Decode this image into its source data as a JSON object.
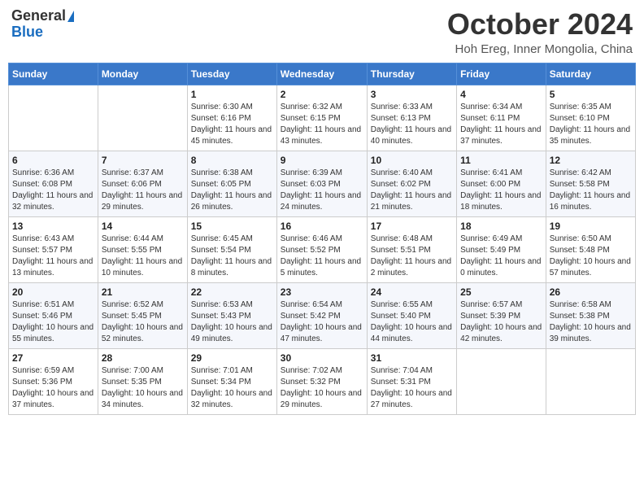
{
  "header": {
    "logo_general": "General",
    "logo_blue": "Blue",
    "month": "October 2024",
    "location": "Hoh Ereg, Inner Mongolia, China"
  },
  "weekdays": [
    "Sunday",
    "Monday",
    "Tuesday",
    "Wednesday",
    "Thursday",
    "Friday",
    "Saturday"
  ],
  "weeks": [
    [
      {
        "day": "",
        "sunrise": "",
        "sunset": "",
        "daylight": ""
      },
      {
        "day": "",
        "sunrise": "",
        "sunset": "",
        "daylight": ""
      },
      {
        "day": "1",
        "sunrise": "Sunrise: 6:30 AM",
        "sunset": "Sunset: 6:16 PM",
        "daylight": "Daylight: 11 hours and 45 minutes."
      },
      {
        "day": "2",
        "sunrise": "Sunrise: 6:32 AM",
        "sunset": "Sunset: 6:15 PM",
        "daylight": "Daylight: 11 hours and 43 minutes."
      },
      {
        "day": "3",
        "sunrise": "Sunrise: 6:33 AM",
        "sunset": "Sunset: 6:13 PM",
        "daylight": "Daylight: 11 hours and 40 minutes."
      },
      {
        "day": "4",
        "sunrise": "Sunrise: 6:34 AM",
        "sunset": "Sunset: 6:11 PM",
        "daylight": "Daylight: 11 hours and 37 minutes."
      },
      {
        "day": "5",
        "sunrise": "Sunrise: 6:35 AM",
        "sunset": "Sunset: 6:10 PM",
        "daylight": "Daylight: 11 hours and 35 minutes."
      }
    ],
    [
      {
        "day": "6",
        "sunrise": "Sunrise: 6:36 AM",
        "sunset": "Sunset: 6:08 PM",
        "daylight": "Daylight: 11 hours and 32 minutes."
      },
      {
        "day": "7",
        "sunrise": "Sunrise: 6:37 AM",
        "sunset": "Sunset: 6:06 PM",
        "daylight": "Daylight: 11 hours and 29 minutes."
      },
      {
        "day": "8",
        "sunrise": "Sunrise: 6:38 AM",
        "sunset": "Sunset: 6:05 PM",
        "daylight": "Daylight: 11 hours and 26 minutes."
      },
      {
        "day": "9",
        "sunrise": "Sunrise: 6:39 AM",
        "sunset": "Sunset: 6:03 PM",
        "daylight": "Daylight: 11 hours and 24 minutes."
      },
      {
        "day": "10",
        "sunrise": "Sunrise: 6:40 AM",
        "sunset": "Sunset: 6:02 PM",
        "daylight": "Daylight: 11 hours and 21 minutes."
      },
      {
        "day": "11",
        "sunrise": "Sunrise: 6:41 AM",
        "sunset": "Sunset: 6:00 PM",
        "daylight": "Daylight: 11 hours and 18 minutes."
      },
      {
        "day": "12",
        "sunrise": "Sunrise: 6:42 AM",
        "sunset": "Sunset: 5:58 PM",
        "daylight": "Daylight: 11 hours and 16 minutes."
      }
    ],
    [
      {
        "day": "13",
        "sunrise": "Sunrise: 6:43 AM",
        "sunset": "Sunset: 5:57 PM",
        "daylight": "Daylight: 11 hours and 13 minutes."
      },
      {
        "day": "14",
        "sunrise": "Sunrise: 6:44 AM",
        "sunset": "Sunset: 5:55 PM",
        "daylight": "Daylight: 11 hours and 10 minutes."
      },
      {
        "day": "15",
        "sunrise": "Sunrise: 6:45 AM",
        "sunset": "Sunset: 5:54 PM",
        "daylight": "Daylight: 11 hours and 8 minutes."
      },
      {
        "day": "16",
        "sunrise": "Sunrise: 6:46 AM",
        "sunset": "Sunset: 5:52 PM",
        "daylight": "Daylight: 11 hours and 5 minutes."
      },
      {
        "day": "17",
        "sunrise": "Sunrise: 6:48 AM",
        "sunset": "Sunset: 5:51 PM",
        "daylight": "Daylight: 11 hours and 2 minutes."
      },
      {
        "day": "18",
        "sunrise": "Sunrise: 6:49 AM",
        "sunset": "Sunset: 5:49 PM",
        "daylight": "Daylight: 11 hours and 0 minutes."
      },
      {
        "day": "19",
        "sunrise": "Sunrise: 6:50 AM",
        "sunset": "Sunset: 5:48 PM",
        "daylight": "Daylight: 10 hours and 57 minutes."
      }
    ],
    [
      {
        "day": "20",
        "sunrise": "Sunrise: 6:51 AM",
        "sunset": "Sunset: 5:46 PM",
        "daylight": "Daylight: 10 hours and 55 minutes."
      },
      {
        "day": "21",
        "sunrise": "Sunrise: 6:52 AM",
        "sunset": "Sunset: 5:45 PM",
        "daylight": "Daylight: 10 hours and 52 minutes."
      },
      {
        "day": "22",
        "sunrise": "Sunrise: 6:53 AM",
        "sunset": "Sunset: 5:43 PM",
        "daylight": "Daylight: 10 hours and 49 minutes."
      },
      {
        "day": "23",
        "sunrise": "Sunrise: 6:54 AM",
        "sunset": "Sunset: 5:42 PM",
        "daylight": "Daylight: 10 hours and 47 minutes."
      },
      {
        "day": "24",
        "sunrise": "Sunrise: 6:55 AM",
        "sunset": "Sunset: 5:40 PM",
        "daylight": "Daylight: 10 hours and 44 minutes."
      },
      {
        "day": "25",
        "sunrise": "Sunrise: 6:57 AM",
        "sunset": "Sunset: 5:39 PM",
        "daylight": "Daylight: 10 hours and 42 minutes."
      },
      {
        "day": "26",
        "sunrise": "Sunrise: 6:58 AM",
        "sunset": "Sunset: 5:38 PM",
        "daylight": "Daylight: 10 hours and 39 minutes."
      }
    ],
    [
      {
        "day": "27",
        "sunrise": "Sunrise: 6:59 AM",
        "sunset": "Sunset: 5:36 PM",
        "daylight": "Daylight: 10 hours and 37 minutes."
      },
      {
        "day": "28",
        "sunrise": "Sunrise: 7:00 AM",
        "sunset": "Sunset: 5:35 PM",
        "daylight": "Daylight: 10 hours and 34 minutes."
      },
      {
        "day": "29",
        "sunrise": "Sunrise: 7:01 AM",
        "sunset": "Sunset: 5:34 PM",
        "daylight": "Daylight: 10 hours and 32 minutes."
      },
      {
        "day": "30",
        "sunrise": "Sunrise: 7:02 AM",
        "sunset": "Sunset: 5:32 PM",
        "daylight": "Daylight: 10 hours and 29 minutes."
      },
      {
        "day": "31",
        "sunrise": "Sunrise: 7:04 AM",
        "sunset": "Sunset: 5:31 PM",
        "daylight": "Daylight: 10 hours and 27 minutes."
      },
      {
        "day": "",
        "sunrise": "",
        "sunset": "",
        "daylight": ""
      },
      {
        "day": "",
        "sunrise": "",
        "sunset": "",
        "daylight": ""
      }
    ]
  ]
}
